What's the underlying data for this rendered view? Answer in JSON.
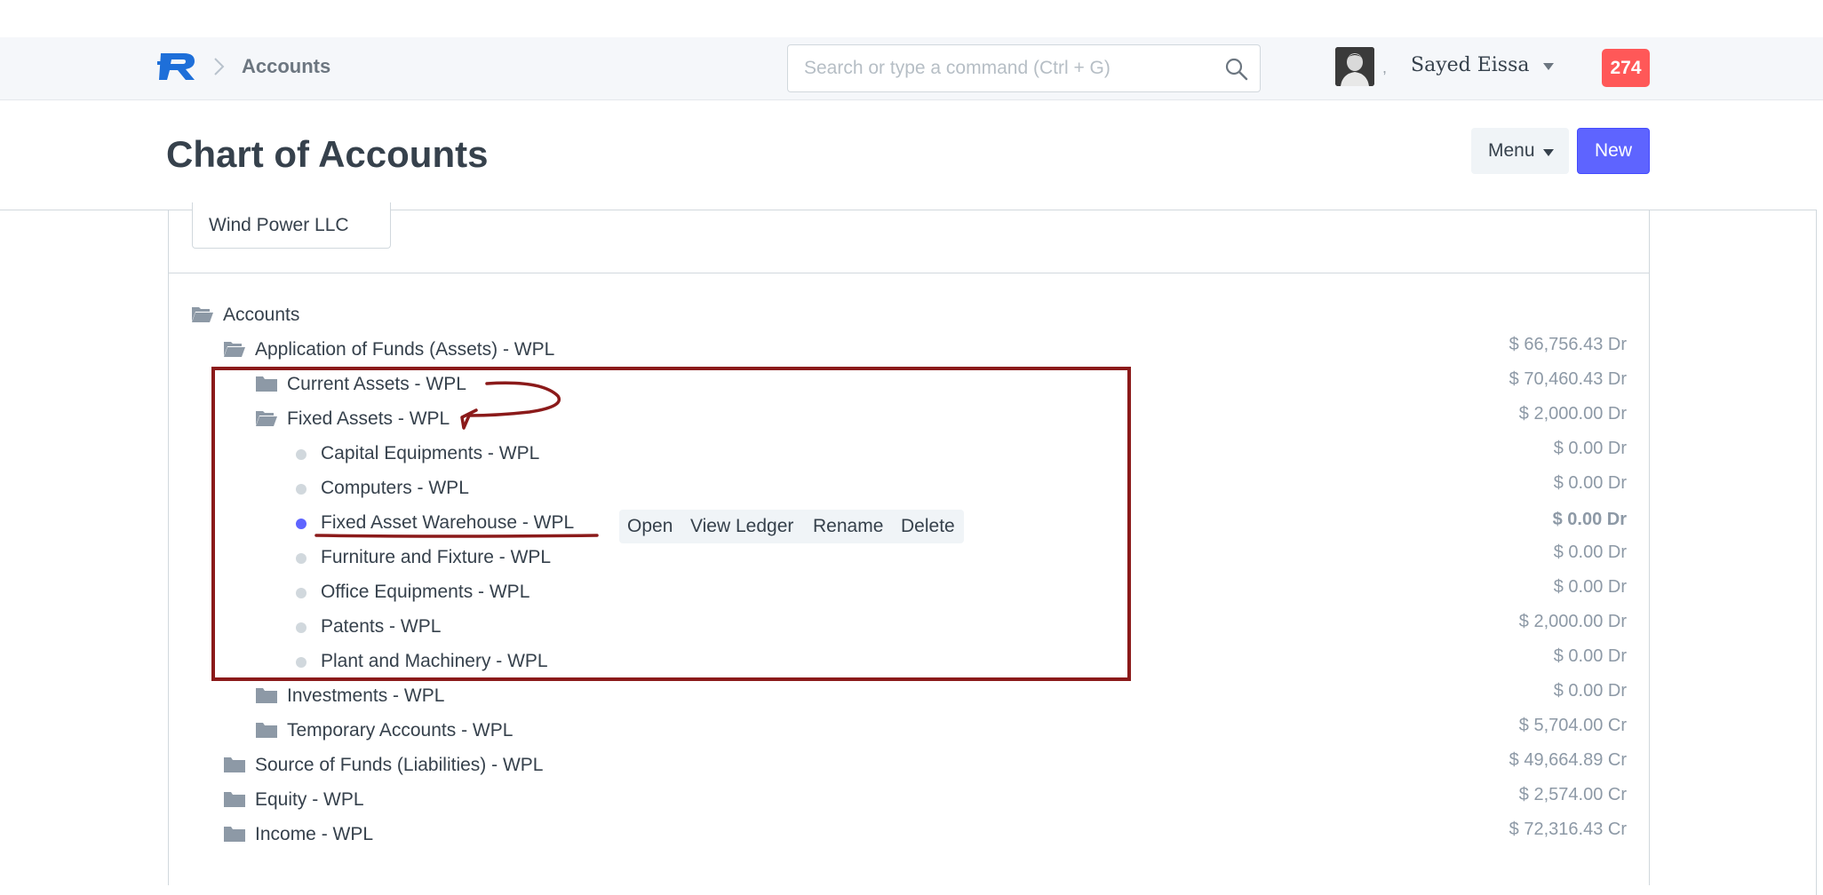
{
  "navbar": {
    "breadcrumb_label": "Accounts",
    "search_placeholder": "Search or type a command (Ctrl + G)",
    "search_value": "",
    "user_name": "Sayed Eissa",
    "avatar_separator": ",",
    "notification_count": "274"
  },
  "header": {
    "title": "Chart of Accounts",
    "menu_label": "Menu",
    "new_label": "New"
  },
  "filters": {
    "company": "Wind Power LLC"
  },
  "tree": {
    "root": "Accounts",
    "rows": [
      {
        "label": "Application of Funds (Assets) - WPL",
        "balance": "$ 66,756.43 Dr"
      },
      {
        "label": "Current Assets - WPL",
        "balance": "$ 70,460.43 Dr"
      },
      {
        "label": "Fixed Assets - WPL",
        "balance": "$ 2,000.00 Dr"
      },
      {
        "label": "Capital Equipments - WPL",
        "balance": "$ 0.00 Dr"
      },
      {
        "label": "Computers - WPL",
        "balance": "$ 0.00 Dr"
      },
      {
        "label": "Fixed Asset Warehouse - WPL",
        "balance": "$ 0.00 Dr"
      },
      {
        "label": "Furniture and Fixture - WPL",
        "balance": "$ 0.00 Dr"
      },
      {
        "label": "Office Equipments - WPL",
        "balance": "$ 0.00 Dr"
      },
      {
        "label": "Patents - WPL",
        "balance": "$ 2,000.00 Dr"
      },
      {
        "label": "Plant and Machinery - WPL",
        "balance": "$ 0.00 Dr"
      },
      {
        "label": "Investments - WPL",
        "balance": "$ 0.00 Dr"
      },
      {
        "label": "Temporary Accounts - WPL",
        "balance": "$ 5,704.00 Cr"
      },
      {
        "label": "Source of Funds (Liabilities) - WPL",
        "balance": "$ 49,664.89 Cr"
      },
      {
        "label": "Equity - WPL",
        "balance": "$ 2,574.00 Cr"
      },
      {
        "label": "Income - WPL",
        "balance": "$ 72,316.43 Cr"
      }
    ]
  },
  "node_actions": {
    "open": "Open",
    "view_ledger": "View Ledger",
    "rename": "Rename",
    "delete": "Delete"
  },
  "colors": {
    "primary": "#5e64ff",
    "badge": "#ff5858",
    "annotation": "#8b1a1a",
    "text": "#36414c",
    "muted": "#8d99a6"
  }
}
